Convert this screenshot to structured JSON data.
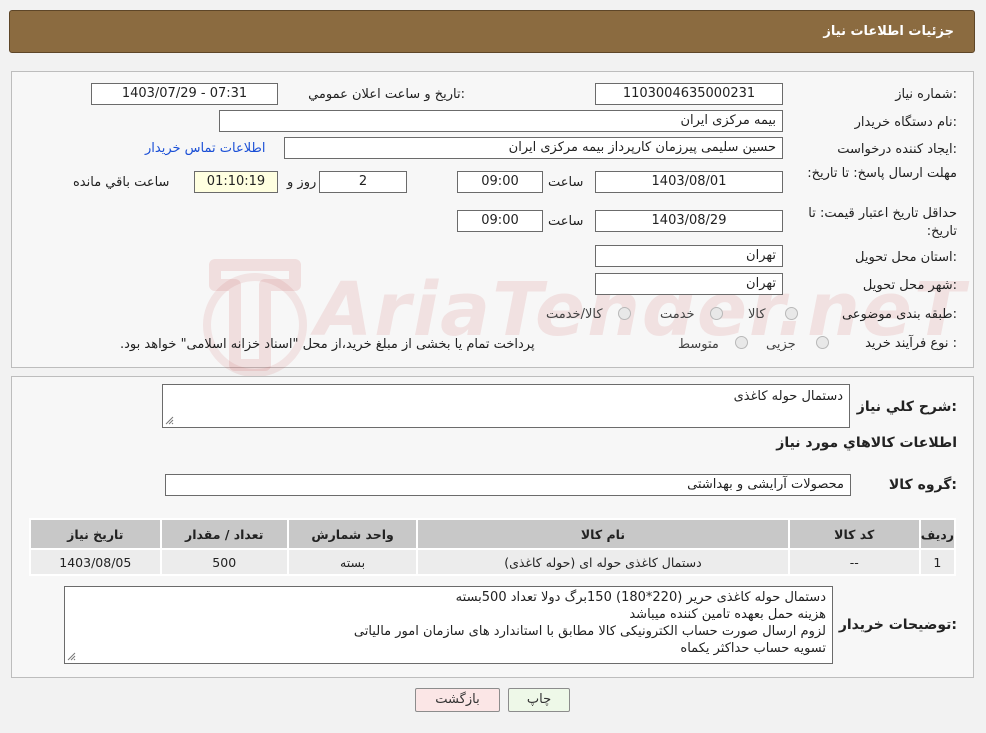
{
  "header": {
    "title": "جزئیات اطلاعات نیاز"
  },
  "watermark": {
    "text": "AriaTender.neT"
  },
  "form": {
    "need_number": {
      "label": "شماره نیاز:",
      "value": "1103004635000231"
    },
    "announce": {
      "label": "تاریخ و ساعت اعلان عمومي:",
      "value": "1403/07/29 - 07:31"
    },
    "buyer_org": {
      "label": "نام دستگاه خریدار:",
      "value": "بیمه مرکزی ایران"
    },
    "requester": {
      "label": "ایجاد کننده درخواست:",
      "value": "حسین سلیمی پیرزمان کارپرداز بیمه مرکزی ایران",
      "contact_link": "اطلاعات تماس خریدار"
    },
    "reply_deadline": {
      "label": "مهلت ارسال پاسخ: تا تاریخ:",
      "date": "1403/08/01",
      "time_label": "ساعت",
      "time": "09:00",
      "days": "2",
      "days_label": "روز و",
      "remaining": "01:10:19",
      "remaining_label": "ساعت باقي مانده"
    },
    "price_validity": {
      "label": "حداقل تاریخ اعتبار قیمت: تا تاریخ:",
      "date": "1403/08/29",
      "time_label": "ساعت",
      "time": "09:00"
    },
    "province": {
      "label": "استان محل تحویل:",
      "value": "تهران"
    },
    "city": {
      "label": "شهر محل تحویل:",
      "value": "تهران"
    },
    "category": {
      "label": "طبقه بندی موضوعی:",
      "options": [
        "کالا",
        "خدمت",
        "کالا/خدمت"
      ]
    },
    "process": {
      "label": "نوع فرآیند خرید :",
      "options": [
        "جزیی",
        "متوسط"
      ],
      "note": "پرداخت تمام یا بخشی از مبلغ خرید،از محل \"اسناد خزانه اسلامی\" خواهد بود."
    }
  },
  "summary": {
    "label": "شرح کلي نیاز:",
    "value": "دستمال حوله کاغذی"
  },
  "goods_info": {
    "title": "اطلاعات کالاهاي مورد نیاز",
    "group_label": "گروه کالا:",
    "group_value": "محصولات آرایشی و بهداشتی"
  },
  "table": {
    "headers": [
      "ردیف",
      "کد کالا",
      "نام کالا",
      "واحد شمارش",
      "تعداد / مقدار",
      "تاریخ نیاز"
    ],
    "rows": [
      [
        "1",
        "--",
        "دستمال کاغذی حوله ای (حوله کاغذی)",
        "بسته",
        "500",
        "1403/08/05"
      ]
    ]
  },
  "buyer_notes": {
    "label": "توضیحات خریدار:",
    "lines": [
      "دستمال حوله کاغذی حریر (220*180) 150برگ دولا تعداد 500بسته",
      "هزینه حمل بعهده تامین کننده میباشد",
      "لزوم ارسال صورت حساب الکترونیکی کالا مطابق با استاندارد های سازمان امور مالیاتی",
      "تسویه حساب حداکثر یکماه"
    ]
  },
  "buttons": {
    "print": "چاپ",
    "back": "بازگشت"
  },
  "colors": {
    "header": "#8b6b40",
    "link": "#1a4fd6",
    "print_btn": "#eef8e8",
    "back_btn": "#fbe6e6"
  }
}
